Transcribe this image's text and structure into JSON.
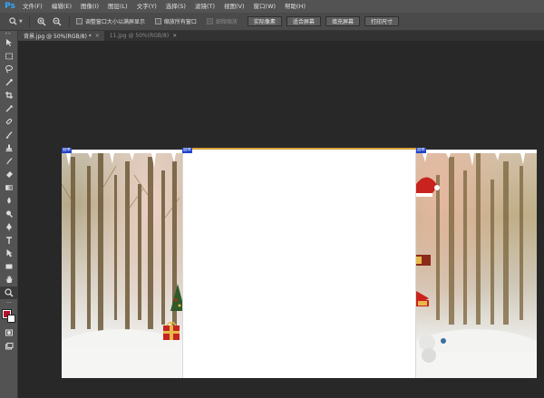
{
  "app": {
    "logo": "Ps"
  },
  "menu": [
    "文件(F)",
    "编辑(E)",
    "图像(I)",
    "图层(L)",
    "文字(Y)",
    "选择(S)",
    "滤镜(T)",
    "视图(V)",
    "窗口(W)",
    "帮助(H)"
  ],
  "options": {
    "resize_windows_label": "调整窗口大小以满屏显示",
    "zoom_all_label": "缩放所有窗口",
    "scrubby_zoom_label": "细微缩放",
    "actual_pixels_label": "实际像素",
    "fit_screen_label": "适合屏幕",
    "fill_screen_label": "填充屏幕",
    "print_size_label": "打印尺寸"
  },
  "tabs": [
    {
      "label": "背景.jpg @ 50%(RGB/8) *",
      "active": true
    },
    {
      "label": "11.jpg @ 50%(RGB/8)",
      "active": false
    }
  ],
  "tools": [
    "move-tool",
    "marquee-tool",
    "lasso-tool",
    "quick-select-tool",
    "crop-tool",
    "eyedropper-tool",
    "spot-heal-tool",
    "brush-tool",
    "clone-stamp-tool",
    "history-brush-tool",
    "eraser-tool",
    "gradient-tool",
    "blur-tool",
    "dodge-tool",
    "pen-tool",
    "type-tool",
    "path-select-tool",
    "rectangle-tool",
    "hand-tool",
    "zoom-tool"
  ],
  "colors": {
    "foreground": "#b5102e",
    "background": "#ffffff"
  },
  "canvas": {
    "badge_left": "副本",
    "badge_mid": "副本",
    "badge_right": "副本"
  }
}
